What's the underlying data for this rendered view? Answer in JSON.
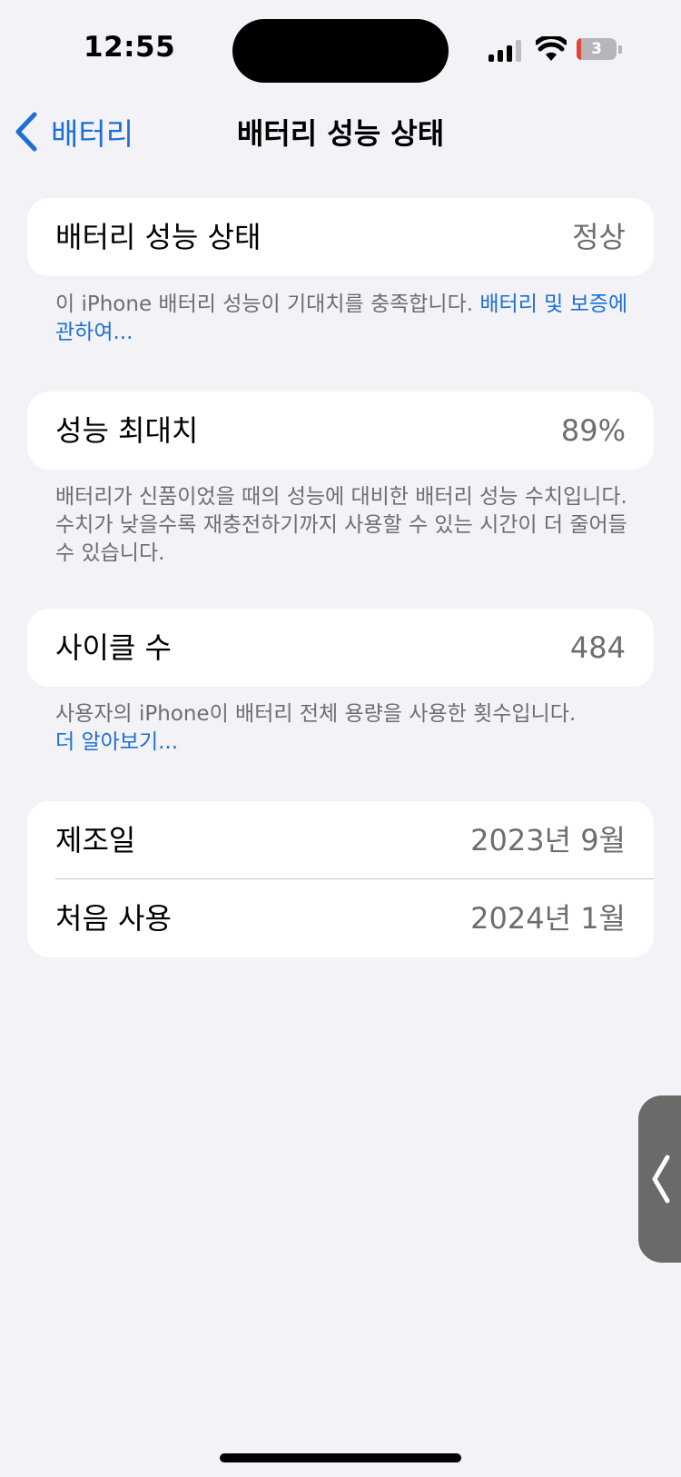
{
  "status_bar": {
    "time": "12:55",
    "battery_level": "3",
    "icons": [
      "cellular-signal-icon",
      "wifi-icon",
      "battery-icon"
    ]
  },
  "nav": {
    "back_label": "배터리",
    "title": "배터리 성능 상태",
    "accent_color": "#1c6fd6"
  },
  "health_card": {
    "label": "배터리 성능 상태",
    "value": "정상",
    "footnote_text": "이 iPhone 배터리 성능이 기대치를 충족합니다. ",
    "footnote_link": "배터리 및 보증에 관하여..."
  },
  "capacity_card": {
    "label": "성능 최대치",
    "value": "89%",
    "footnote_text": "배터리가 신품이었을 때의 성능에 대비한 배터리 성능 수치입니다. 수치가 낮을수록 재충전하기까지 사용할 수 있는 시간이 더 줄어들 수 있습니다."
  },
  "cycle_card": {
    "label": "사이클 수",
    "value": "484",
    "footnote_text": "사용자의 iPhone이 배터리 전체 용량을 사용한 횟수입니다.",
    "footnote_link": "더 알아보기..."
  },
  "dates_card": {
    "rows": [
      {
        "label": "제조일",
        "value": "2023년 9월"
      },
      {
        "label": "처음 사용",
        "value": "2024년 1월"
      }
    ]
  }
}
